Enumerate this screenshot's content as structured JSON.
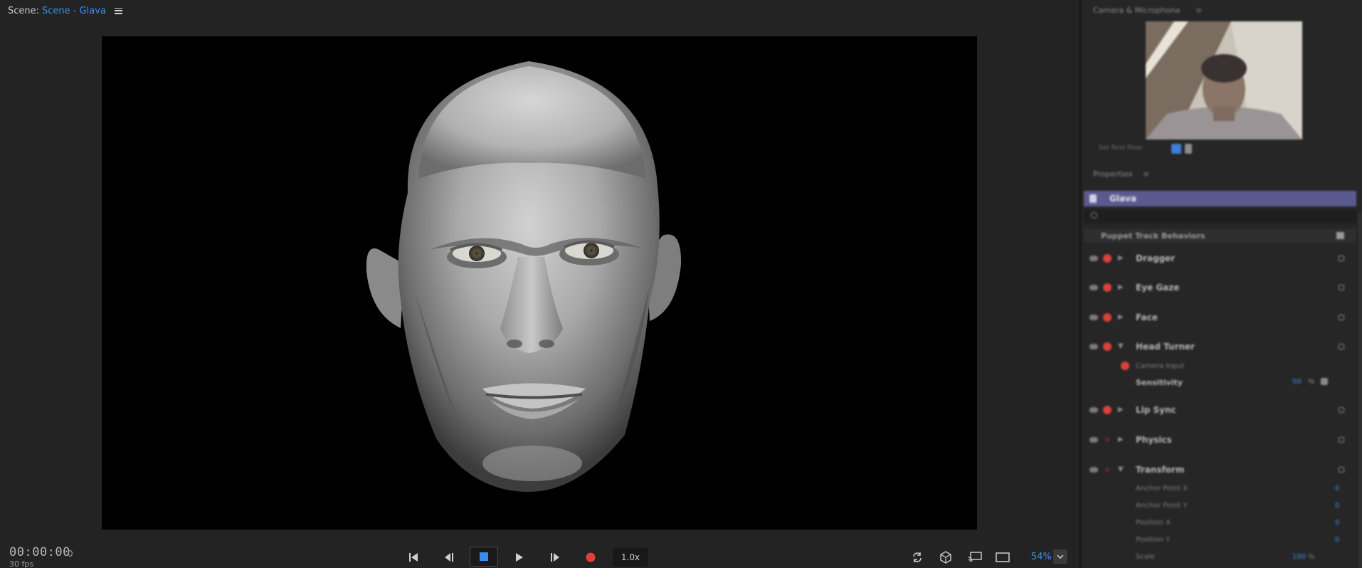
{
  "scene": {
    "prefix": "Scene:",
    "name": "Scene - Glava"
  },
  "transport": {
    "timecode": "00:00:00",
    "frame": "0",
    "fps": "30 fps",
    "speed": "1.0x",
    "zoom": "54%",
    "record_color": "#e0403a",
    "accent_color": "#3d8ee8"
  },
  "right_panel": {
    "camera_title": "Camera & Microphone",
    "camera_toolbar_label": "Set Rest Pose",
    "properties_title": "Properties",
    "selected_item": "Glava",
    "behaviors_header": "Puppet Track Behaviors",
    "behaviors": [
      {
        "label": "Dragger",
        "armed": true
      },
      {
        "label": "Eye Gaze",
        "armed": true
      },
      {
        "label": "Face",
        "armed": true
      },
      {
        "label": "Head Turner",
        "armed": true
      },
      {
        "label": "Lip Sync",
        "armed": true
      },
      {
        "label": "Physics",
        "armed": false
      },
      {
        "label": "Transform",
        "armed": false
      }
    ],
    "head_turner_input": "Camera Input",
    "sensitivity_label": "Sensitivity",
    "sensitivity_value": "50",
    "sensitivity_unit": "%",
    "transform_params": [
      {
        "label": "Anchor Point X",
        "value": "0"
      },
      {
        "label": "Anchor Point Y",
        "value": "0"
      },
      {
        "label": "Position X",
        "value": "0"
      },
      {
        "label": "Position Y",
        "value": "0"
      },
      {
        "label": "Scale",
        "value": "100"
      }
    ],
    "scale_unit": "%"
  }
}
